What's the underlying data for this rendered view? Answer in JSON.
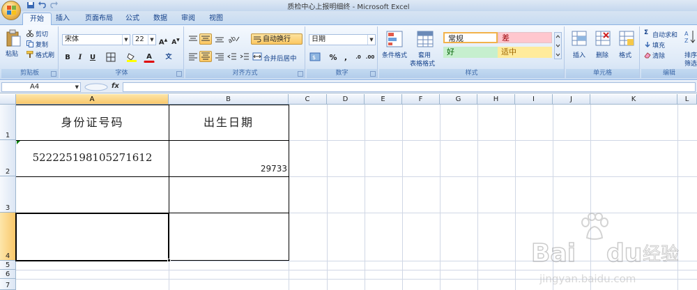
{
  "window": {
    "title": "质检中心上报明细终 - Microsoft Excel"
  },
  "tabs": [
    "开始",
    "插入",
    "页面布局",
    "公式",
    "数据",
    "审阅",
    "视图"
  ],
  "ribbon": {
    "clipboard": {
      "paste": "粘贴",
      "cut": "剪切",
      "copy": "复制",
      "format_painter": "格式刷",
      "label": "剪贴板"
    },
    "font": {
      "name": "宋体",
      "size": "22",
      "label": "字体"
    },
    "alignment": {
      "wrap": "自动换行",
      "merge": "合并后居中",
      "label": "对齐方式"
    },
    "number": {
      "format": "日期",
      "label": "数字"
    },
    "styles": {
      "conditional": "条件格式",
      "table": "套用\n表格格式",
      "table_l1": "套用",
      "table_l2": "表格格式",
      "normal": "常规",
      "bad": "差",
      "good": "好",
      "neutral": "适中",
      "label": "样式"
    },
    "cells": {
      "insert": "插入",
      "delete": "删除",
      "format": "格式",
      "label": "单元格"
    },
    "editing": {
      "autosum": "自动求和",
      "fill": "填充",
      "clear": "清除",
      "sort_1": "排序",
      "sort_2": "筛选",
      "label": "编辑"
    }
  },
  "formula_bar": {
    "name_box": "A4",
    "fx": "fx",
    "content": ""
  },
  "sheet": {
    "columns": [
      "A",
      "B",
      "C",
      "D",
      "E",
      "F",
      "G",
      "H",
      "I",
      "J",
      "K",
      "L"
    ],
    "rows": [
      "1",
      "2",
      "3",
      "4",
      "5",
      "6",
      "7"
    ],
    "selected_col": "A",
    "selected_row": "4",
    "cells": {
      "A1": "身份证号码",
      "B1": "出生日期",
      "A2": "522225198105271612",
      "B2": "29733"
    }
  },
  "watermark": {
    "brand": "Baidu经验",
    "url": "jingyan.baidu.com"
  },
  "colors": {
    "accent": "#15428b",
    "selected_header": "#f9c76a",
    "bad_fill": "#ffc7ce",
    "good_fill": "#c6efce",
    "neutral_fill": "#ffeb9c"
  }
}
